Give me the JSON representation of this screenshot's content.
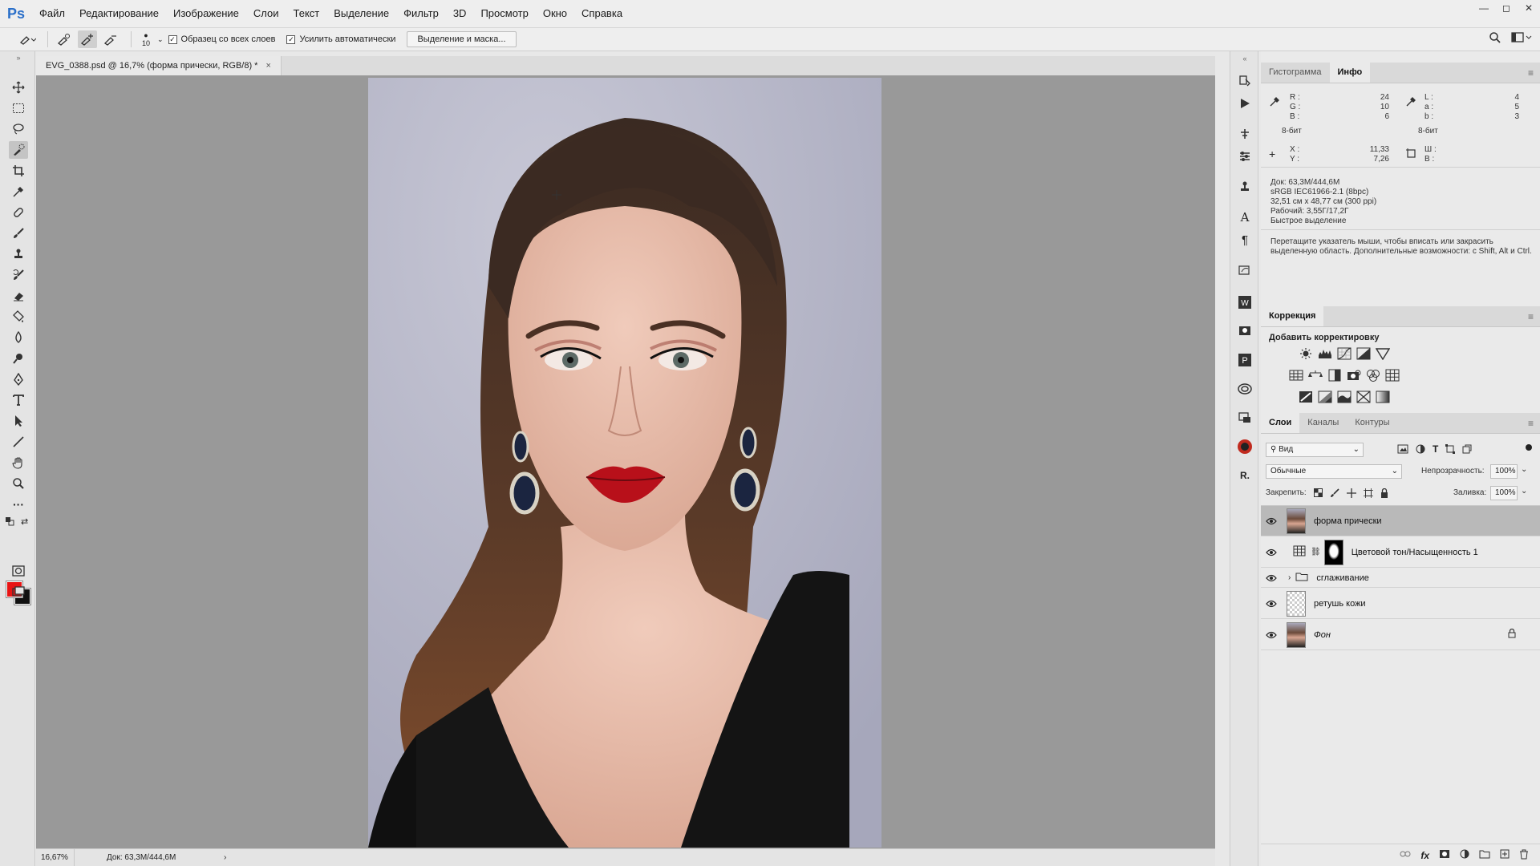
{
  "app": {
    "logo": "Ps"
  },
  "menu": [
    "Файл",
    "Редактирование",
    "Изображение",
    "Слои",
    "Текст",
    "Выделение",
    "Фильтр",
    "3D",
    "Просмотр",
    "Окно",
    "Справка"
  ],
  "window_controls": {
    "minimize": "—",
    "maximize": "◻",
    "close": "✕"
  },
  "options": {
    "brush_size": "10",
    "sample_all_layers": "Образец со всех слоев",
    "auto_enhance": "Усилить автоматически",
    "select_mask": "Выделение и маска..."
  },
  "document": {
    "tab_title": "EVG_0388.psd @ 16,7% (форма прически, RGB/8) *",
    "tab_close": "×"
  },
  "colors": {
    "foreground": "#e81515",
    "background": "#111111"
  },
  "status": {
    "zoom": "16,67%",
    "doc": "Док: 63,3M/444,6M",
    "arrow": "›"
  },
  "info_panel": {
    "tabs": [
      "Гистограмма",
      "Инфо"
    ],
    "rgb_labels": [
      "R :",
      "G :",
      "B :"
    ],
    "rgb_values": [
      "24",
      "10",
      "6"
    ],
    "lab_labels": [
      "L :",
      "a :",
      "b :"
    ],
    "lab_values": [
      "4",
      "5",
      "3"
    ],
    "bit_left": "8-бит",
    "bit_right": "8-бит",
    "xy_labels": [
      "X :",
      "Y :"
    ],
    "xy_values": [
      "11,33",
      "7,26"
    ],
    "wh_labels": [
      "Ш :",
      "В :"
    ],
    "doc_lines": [
      "Док: 63,3M/444,6M",
      "sRGB IEC61966-2.1 (8bpc)",
      "32,51 см x 48,77 см (300 ppi)",
      "Рабочий: 3,55Г/17,2Г",
      "Быстрое выделение"
    ],
    "hint": "Перетащите указатель мыши, чтобы вписать или закрасить выделенную область. Дополнительные возможности: с Shift, Alt и Ctrl."
  },
  "correction_panel": {
    "tab": "Коррекция",
    "title": "Добавить корректировку"
  },
  "layers_panel": {
    "tabs": [
      "Слои",
      "Каналы",
      "Контуры"
    ],
    "filter": "Вид",
    "blend_mode": "Обычные",
    "opacity_label": "Непрозрачность:",
    "opacity": "100%",
    "lock_label": "Закрепить:",
    "fill_label": "Заливка:",
    "fill": "100%",
    "layers": [
      {
        "name": "форма прически"
      },
      {
        "name": "Цветовой тон/Насыщенность 1"
      },
      {
        "name": "сглаживание"
      },
      {
        "name": "ретушь кожи"
      },
      {
        "name": "Фон"
      }
    ]
  }
}
